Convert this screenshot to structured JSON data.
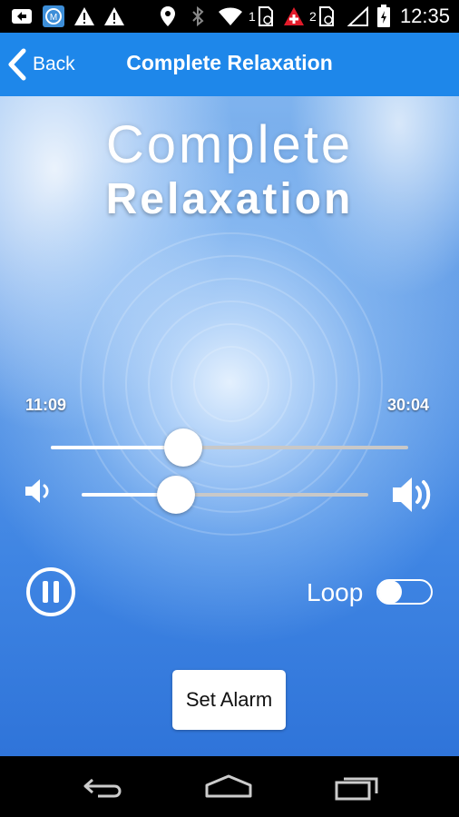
{
  "status_bar": {
    "time": "12:35",
    "sim1_label": "1",
    "sim2_label": "2",
    "icons": [
      "usb-back-icon",
      "app-m-icon",
      "warning-icon",
      "warning-icon",
      "location-icon",
      "bluetooth-icon",
      "wifi-icon",
      "sim-1-icon",
      "medical-cross-icon",
      "sim-2-icon",
      "no-signal-icon",
      "battery-icon"
    ]
  },
  "header": {
    "back_label": "Back",
    "title": "Complete Relaxation",
    "color": "#1e87ea"
  },
  "player": {
    "logo_line1": "Complete",
    "logo_line2": "Relaxation",
    "elapsed": "11:09",
    "total": "30:04",
    "progress_fraction": 0.37,
    "volume_fraction": 0.33,
    "loop_label": "Loop",
    "loop_on": false,
    "set_alarm_label": "Set Alarm"
  },
  "nav_bar": {
    "icons": [
      "back-icon",
      "home-icon",
      "recent-apps-icon"
    ]
  }
}
